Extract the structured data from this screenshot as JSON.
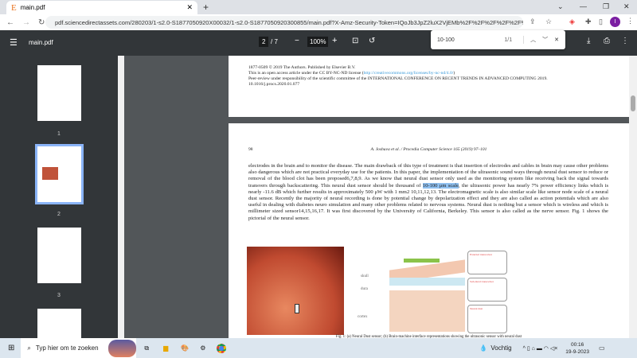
{
  "browser": {
    "tab_title": "main.pdf",
    "url": "pdf.sciencedirectassets.com/280203/1-s2.0-S1877050920X00032/1-s2.0-S1877050920300855/main.pdf?X-Amz-Security-Token=IQoJb3JpZ2luX2VjEMb%2F%2F%2F%2F%2F%2F%2F..."
  },
  "pdf_toolbar": {
    "title": "main.pdf",
    "page_current": "2",
    "page_total": "/ 7",
    "zoom": "100%"
  },
  "find": {
    "query": "10-100",
    "count": "1/1"
  },
  "thumbnails": [
    {
      "label": "1"
    },
    {
      "label": "2"
    },
    {
      "label": "3"
    }
  ],
  "page1_footer": {
    "line1": "1877-0509 © 2019 The Authors. Published by Elsevier B.V.",
    "line2_prefix": "This is an open access article under the CC BY-NC-ND license (",
    "line2_link": "http://creativecommons.org/licenses/by-nc-nd/4.0/",
    "line2_suffix": ")",
    "line3": "Peer-review under responsibility of the scientific committee of the INTERNATIONAL CONFERENCE ON RECENT TRENDS IN ADVANCED COMPUTING 2019.",
    "line4": "10.1016/j.procs.2020.01.077"
  },
  "page2": {
    "page_number": "98",
    "running_head": "A. Joshuva et al. / Procedia Computer Science 165 (2019) 97–101",
    "para_a": "electrodes in the brain and to monitor the disease. The main drawback of this type of treatment is that insertion of electrodes and cables in brain may cause other problems also dangerous which are not practical everyday use for the patients. In this paper, the implementation of the ultrasonic sound ways through neural dust sensor to reduce or removal of the blood clot has been proposed6,7,8,9. As we know that neural dust sensor only used as the monitoring system like receiving back the signal towards transvers through backscattering. This neural dust sensor should be thousand of ",
    "para_highlight": "10-100 μm scale",
    "para_b": ", the ultrasonic power has nearly 7% power efficiency links which is nearly -11.6 dB which further results in approximately 500 μW with 1 mm2 10,11,12,13. The electromagnetic scale is also similar scale like sensor node scale of a neural dust sensor. Recently the majority of neural recording is done by potential change by depolarization effect and they are also called as action potentials which are also useful in dealing with diabetes neuro simulation and many other problems related to nervous systems. Neural dust is nothing but a sensor which is wireless and which is millimeter sized sensor14,15,16,17. It was first discovered by the University of California, Berkeley. This sensor is also called as the nerve sensor. Fig. 1 shows the pictorial of the neural sensor.",
    "diagram_labels": {
      "skull": "skull",
      "dura": "dura",
      "cortex": "cortex",
      "box1": "External transceiver",
      "box2": "Sub-dural transceiver",
      "box3": "Neural dust"
    },
    "caption": "Fig. 1: (a) Neural Dust sensor; (b) Brain-machine interface representations showing the ultrasonic sensor with neural dust"
  },
  "taskbar": {
    "search_placeholder": "Typ hier om te zoeken",
    "weather": "Vochtig",
    "time": "00:16",
    "date": "19-9-2023"
  },
  "colors": {
    "pdf_toolbar": "#323639",
    "viewer_bg": "#525659",
    "highlight": "#8fc0f0",
    "accent": "#8ab4f8"
  }
}
